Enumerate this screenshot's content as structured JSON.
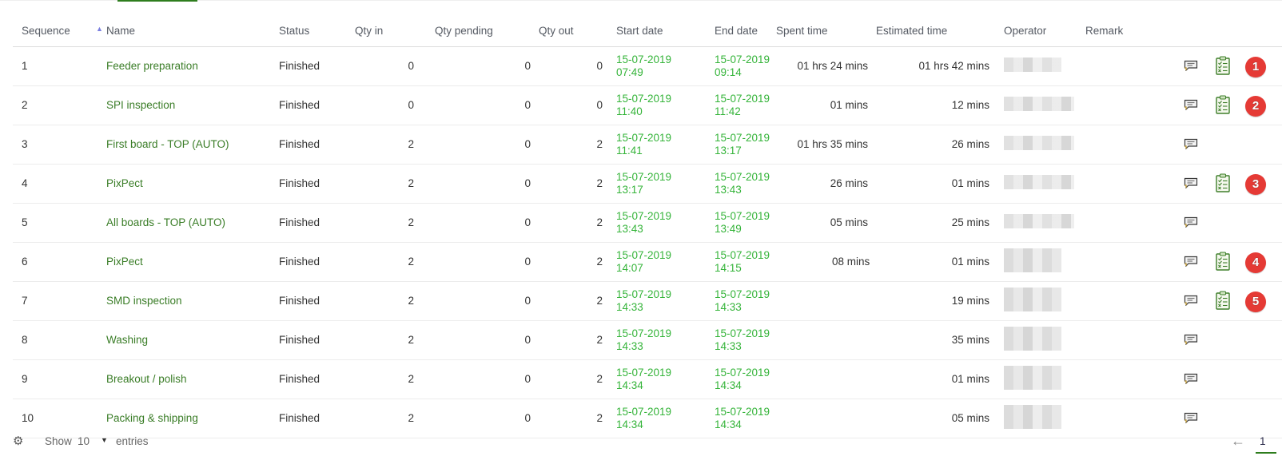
{
  "colors": {
    "accent_green": "#2e7d1e",
    "name_link": "#3a7d27",
    "date_green": "#35b43a",
    "badge_red": "#e53a35",
    "sort_arrow": "#7b7fe0"
  },
  "table": {
    "columns": {
      "sequence": "Sequence",
      "name": "Name",
      "status": "Status",
      "qty_in": "Qty in",
      "qty_pending": "Qty pending",
      "qty_out": "Qty out",
      "start_date": "Start date",
      "end_date": "End date",
      "spent_time": "Spent time",
      "estimated_time": "Estimated time",
      "operator": "Operator",
      "remark": "Remark"
    },
    "sort": {
      "column": "sequence",
      "direction": "ascending",
      "icon": "sort-asc-icon"
    },
    "rows": [
      {
        "seq": "1",
        "name": "Feeder preparation",
        "status": "Finished",
        "qty_in": "0",
        "qty_pending": "0",
        "qty_out": "0",
        "start_date": "15-07-2019",
        "start_time": "07:49",
        "end_date": "15-07-2019",
        "end_time": "09:14",
        "spent": "01 hrs 24 mins",
        "estimated": "01 hrs 42 mins",
        "operator": "[redacted]",
        "remark": "",
        "has_comment": true,
        "has_checklist": true,
        "badge": "1"
      },
      {
        "seq": "2",
        "name": "SPI inspection",
        "status": "Finished",
        "qty_in": "0",
        "qty_pending": "0",
        "qty_out": "0",
        "start_date": "15-07-2019",
        "start_time": "11:40",
        "end_date": "15-07-2019",
        "end_time": "11:42",
        "spent": "01 mins",
        "estimated": "12 mins",
        "operator": "[redacted]",
        "remark": "",
        "has_comment": true,
        "has_checklist": true,
        "badge": "2"
      },
      {
        "seq": "3",
        "name": "First board - TOP (AUTO)",
        "status": "Finished",
        "qty_in": "2",
        "qty_pending": "0",
        "qty_out": "2",
        "start_date": "15-07-2019",
        "start_time": "11:41",
        "end_date": "15-07-2019",
        "end_time": "13:17",
        "spent": "01 hrs 35 mins",
        "estimated": "26 mins",
        "operator": "[redacted]",
        "remark": "",
        "has_comment": true,
        "has_checklist": false,
        "badge": ""
      },
      {
        "seq": "4",
        "name": "PixPect",
        "status": "Finished",
        "qty_in": "2",
        "qty_pending": "0",
        "qty_out": "2",
        "start_date": "15-07-2019",
        "start_time": "13:17",
        "end_date": "15-07-2019",
        "end_time": "13:43",
        "spent": "26 mins",
        "estimated": "01 mins",
        "operator": "[redacted]",
        "remark": "",
        "has_comment": true,
        "has_checklist": true,
        "badge": "3"
      },
      {
        "seq": "5",
        "name": "All boards - TOP (AUTO)",
        "status": "Finished",
        "qty_in": "2",
        "qty_pending": "0",
        "qty_out": "2",
        "start_date": "15-07-2019",
        "start_time": "13:43",
        "end_date": "15-07-2019",
        "end_time": "13:49",
        "spent": "05 mins",
        "estimated": "25 mins",
        "operator": "[redacted]",
        "remark": "",
        "has_comment": true,
        "has_checklist": false,
        "badge": ""
      },
      {
        "seq": "6",
        "name": "PixPect",
        "status": "Finished",
        "qty_in": "2",
        "qty_pending": "0",
        "qty_out": "2",
        "start_date": "15-07-2019",
        "start_time": "14:07",
        "end_date": "15-07-2019",
        "end_time": "14:15",
        "spent": "08 mins",
        "estimated": "01 mins",
        "operator": "[redacted]",
        "remark": "",
        "has_comment": true,
        "has_checklist": true,
        "badge": "4"
      },
      {
        "seq": "7",
        "name": "SMD inspection",
        "status": "Finished",
        "qty_in": "2",
        "qty_pending": "0",
        "qty_out": "2",
        "start_date": "15-07-2019",
        "start_time": "14:33",
        "end_date": "15-07-2019",
        "end_time": "14:33",
        "spent": "",
        "estimated": "19 mins",
        "operator": "[redacted]",
        "remark": "",
        "has_comment": true,
        "has_checklist": true,
        "badge": "5"
      },
      {
        "seq": "8",
        "name": "Washing",
        "status": "Finished",
        "qty_in": "2",
        "qty_pending": "0",
        "qty_out": "2",
        "start_date": "15-07-2019",
        "start_time": "14:33",
        "end_date": "15-07-2019",
        "end_time": "14:33",
        "spent": "",
        "estimated": "35 mins",
        "operator": "[redacted]",
        "remark": "",
        "has_comment": true,
        "has_checklist": false,
        "badge": ""
      },
      {
        "seq": "9",
        "name": "Breakout / polish",
        "status": "Finished",
        "qty_in": "2",
        "qty_pending": "0",
        "qty_out": "2",
        "start_date": "15-07-2019",
        "start_time": "14:34",
        "end_date": "15-07-2019",
        "end_time": "14:34",
        "spent": "",
        "estimated": "01 mins",
        "operator": "[redacted]",
        "remark": "",
        "has_comment": true,
        "has_checklist": false,
        "badge": ""
      },
      {
        "seq": "10",
        "name": "Packing & shipping",
        "status": "Finished",
        "qty_in": "2",
        "qty_pending": "0",
        "qty_out": "2",
        "start_date": "15-07-2019",
        "start_time": "14:34",
        "end_date": "15-07-2019",
        "end_time": "14:34",
        "spent": "",
        "estimated": "05 mins",
        "operator": "[redacted]",
        "remark": "",
        "has_comment": true,
        "has_checklist": false,
        "badge": ""
      }
    ]
  },
  "footer": {
    "settings_icon": "gear-icon",
    "show_label": "Show",
    "page_size": "10",
    "entries_label": "entries",
    "prev_label": "←",
    "current_page": "1"
  }
}
